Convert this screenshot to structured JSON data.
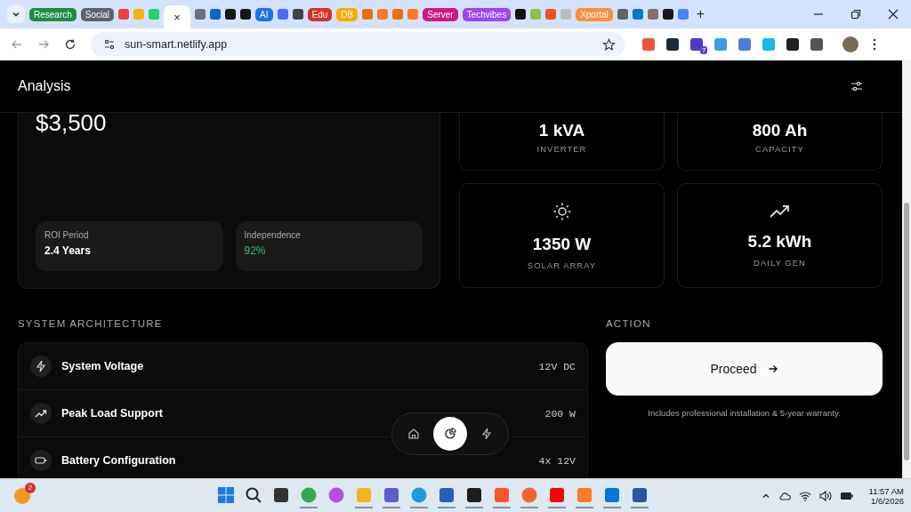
{
  "tab_strip": {
    "items": [
      {
        "kind": "group",
        "label": "Research",
        "color": "#1e8e3e"
      },
      {
        "kind": "group",
        "label": "Social",
        "color": "#5f6368"
      },
      {
        "kind": "favicon",
        "color": "#ea4335"
      },
      {
        "kind": "favicon",
        "color": "#f4b400"
      },
      {
        "kind": "favicon",
        "color": "#25d366"
      },
      {
        "kind": "active",
        "close": "×"
      },
      {
        "kind": "favicon",
        "color": "#6b7280"
      },
      {
        "kind": "favicon",
        "color": "#0a66c2"
      },
      {
        "kind": "favicon",
        "color": "#181717"
      },
      {
        "kind": "favicon",
        "color": "#181717"
      },
      {
        "kind": "group",
        "label": "AI",
        "color": "#1a73e8"
      },
      {
        "kind": "favicon",
        "color": "#4d6bfe"
      },
      {
        "kind": "favicon",
        "color": "#444444"
      },
      {
        "kind": "group",
        "label": "Edu",
        "color": "#d93025"
      },
      {
        "kind": "group",
        "label": "DB",
        "color": "#f9ab00"
      },
      {
        "kind": "favicon",
        "color": "#e8710a"
      },
      {
        "kind": "favicon",
        "color": "#fb7a24"
      },
      {
        "kind": "favicon",
        "color": "#e8710a"
      },
      {
        "kind": "favicon",
        "color": "#fb7a24"
      },
      {
        "kind": "group",
        "label": "Server",
        "color": "#d01884"
      },
      {
        "kind": "group",
        "label": "Techvibes",
        "color": "#a142f4"
      },
      {
        "kind": "favicon",
        "color": "#111111"
      },
      {
        "kind": "favicon",
        "color": "#8bc34a"
      },
      {
        "kind": "favicon",
        "color": "#f24e1e"
      },
      {
        "kind": "favicon",
        "color": "#bdbdbd"
      },
      {
        "kind": "group",
        "label": "Xportal",
        "color": "#fa903e"
      },
      {
        "kind": "favicon",
        "color": "#5f6368"
      },
      {
        "kind": "favicon",
        "color": "#0078d4"
      },
      {
        "kind": "favicon",
        "color": "#8d6e63"
      },
      {
        "kind": "favicon",
        "color": "#181717"
      },
      {
        "kind": "favicon",
        "color": "#4285f4"
      }
    ],
    "new_tab": "+"
  },
  "toolbar": {
    "url": "sun-smart.netlify.app",
    "extensions": [
      {
        "color": "#e8553e"
      },
      {
        "color": "#1b2a36"
      },
      {
        "color": "#4b3bc9",
        "badge": "7"
      },
      {
        "color": "#3d9be9"
      },
      {
        "color": "#4a7fd8"
      },
      {
        "color": "#1ab7ea"
      },
      {
        "color": "#222222"
      },
      {
        "color": "#555555"
      }
    ]
  },
  "page": {
    "title": "Analysis",
    "cost": "$3,500",
    "metrics": [
      {
        "label": "ROI Period",
        "value": "2.4 Years",
        "highlight": false
      },
      {
        "label": "Independence",
        "value": "92%",
        "highlight": true
      }
    ],
    "stats": [
      {
        "kind": "plain",
        "value": "1 kVA",
        "label": "INVERTER"
      },
      {
        "kind": "plain",
        "value": "800 Ah",
        "label": "CAPACITY"
      },
      {
        "kind": "sun",
        "value": "1350 W",
        "label": "SOLAR ARRAY"
      },
      {
        "kind": "trend",
        "value": "5.2 kWh",
        "label": "DAILY GEN"
      }
    ],
    "architecture": {
      "heading": "SYSTEM ARCHITECTURE",
      "rows": [
        {
          "kind": "bolt",
          "label": "System Voltage",
          "value": "12V DC"
        },
        {
          "kind": "trend",
          "label": "Peak Load Support",
          "value": "200 W"
        },
        {
          "kind": "battery",
          "label": "Battery Configuration",
          "value": "4x 12V"
        }
      ]
    },
    "action": {
      "heading": "ACTION",
      "button": "Proceed",
      "note": "Includes professional installation & 5-year warranty."
    },
    "nav": [
      {
        "kind": "home",
        "selected": false
      },
      {
        "kind": "pie",
        "selected": true
      },
      {
        "kind": "bolt",
        "selected": false
      }
    ]
  },
  "taskbar": {
    "notification_badge": "2",
    "apps": [
      {
        "kind": "windows",
        "color": "#1f7ae0",
        "running": false
      },
      {
        "kind": "search",
        "color": "#222222",
        "running": false
      },
      {
        "kind": "square",
        "color": "#333333",
        "running": false
      },
      {
        "kind": "circle",
        "color": "#34a853",
        "running": true
      },
      {
        "kind": "circle",
        "color": "#b84fe0",
        "running": false
      },
      {
        "kind": "square",
        "color": "#f2b51c",
        "running": true
      },
      {
        "kind": "square",
        "color": "#5b5fc7",
        "running": true
      },
      {
        "kind": "circle",
        "color": "#1f9ae0",
        "running": true
      },
      {
        "kind": "square",
        "color": "#2b5eb8",
        "running": true
      },
      {
        "kind": "square",
        "color": "#1e1e1e",
        "running": true
      },
      {
        "kind": "square",
        "color": "#fb542b",
        "running": true
      },
      {
        "kind": "circle",
        "color": "#f2662b",
        "running": true
      },
      {
        "kind": "square",
        "color": "#ff0000",
        "running": true
      },
      {
        "kind": "square",
        "color": "#fb7a24",
        "running": true
      },
      {
        "kind": "square",
        "color": "#0078d4",
        "running": true
      },
      {
        "kind": "square",
        "color": "#2b579a",
        "running": true
      }
    ],
    "time": "11:57 AM",
    "date": "1/6/2026"
  }
}
